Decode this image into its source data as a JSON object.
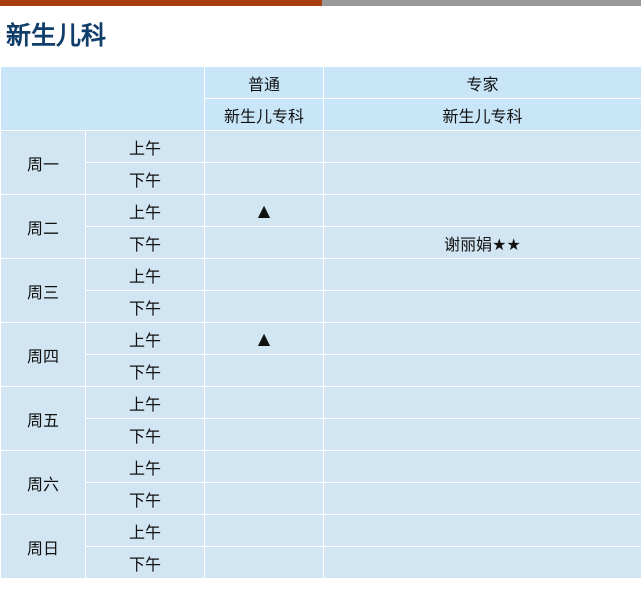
{
  "header": {
    "title": "新生儿科",
    "accent_color": "#a93f10",
    "title_color": "#103e6a"
  },
  "table": {
    "groups": [
      "普通",
      "专家"
    ],
    "specialties": [
      "新生儿专科",
      "新生儿专科"
    ],
    "days": [
      {
        "day": "周一",
        "rows": [
          {
            "period": "上午",
            "regular": "",
            "expert": ""
          },
          {
            "period": "下午",
            "regular": "",
            "expert": ""
          }
        ]
      },
      {
        "day": "周二",
        "rows": [
          {
            "period": "上午",
            "regular": "▲",
            "expert": ""
          },
          {
            "period": "下午",
            "regular": "",
            "expert": "谢丽娟★★"
          }
        ]
      },
      {
        "day": "周三",
        "rows": [
          {
            "period": "上午",
            "regular": "",
            "expert": ""
          },
          {
            "period": "下午",
            "regular": "",
            "expert": ""
          }
        ]
      },
      {
        "day": "周四",
        "rows": [
          {
            "period": "上午",
            "regular": "▲",
            "expert": ""
          },
          {
            "period": "下午",
            "regular": "",
            "expert": ""
          }
        ]
      },
      {
        "day": "周五",
        "rows": [
          {
            "period": "上午",
            "regular": "",
            "expert": ""
          },
          {
            "period": "下午",
            "regular": "",
            "expert": ""
          }
        ]
      },
      {
        "day": "周六",
        "rows": [
          {
            "period": "上午",
            "regular": "",
            "expert": ""
          },
          {
            "period": "下午",
            "regular": "",
            "expert": ""
          }
        ]
      },
      {
        "day": "周日",
        "rows": [
          {
            "period": "上午",
            "regular": "",
            "expert": ""
          },
          {
            "period": "下午",
            "regular": "",
            "expert": ""
          }
        ]
      }
    ]
  }
}
